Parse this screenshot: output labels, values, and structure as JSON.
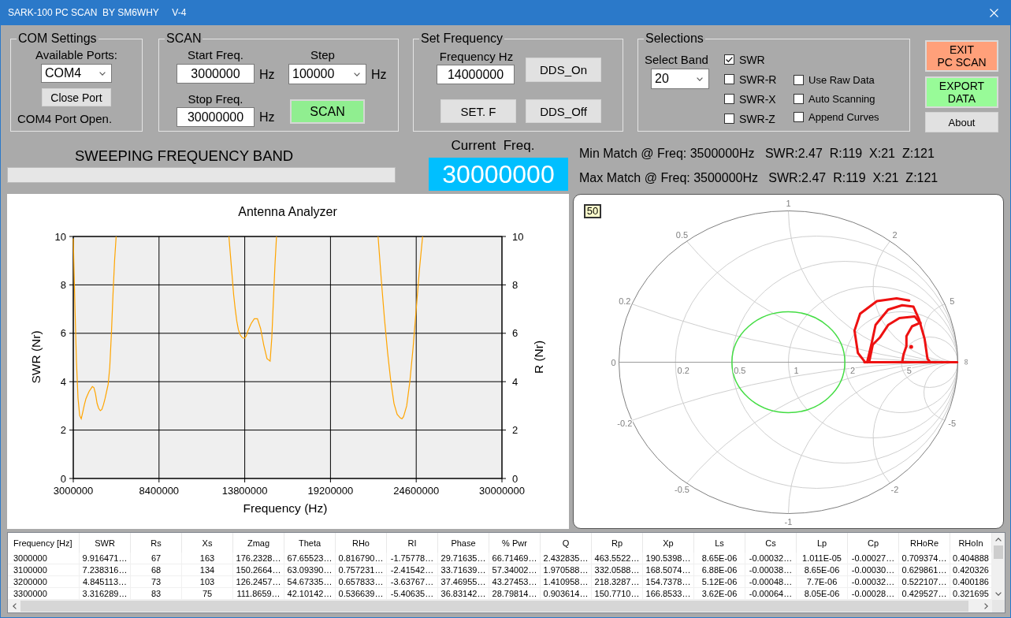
{
  "window": {
    "title": "SARK-100 PC SCAN  BY SM6WHY     V-4"
  },
  "com_settings": {
    "title": "COM Settings",
    "ports_label": "Available Ports:",
    "port": "COM4",
    "close_button": "Close Port",
    "status": "COM4 Port Open."
  },
  "scan": {
    "title": "SCAN",
    "start_label": "Start Freq.",
    "start_value": "3000000",
    "start_unit": "Hz",
    "step_label": "Step",
    "step_value": "100000",
    "step_unit": "Hz",
    "stop_label": "Stop Freq.",
    "stop_value": "30000000",
    "stop_unit": "Hz",
    "scan_button": "SCAN"
  },
  "set_frequency": {
    "title": "Set Frequency",
    "frequency_label": "Frequency Hz",
    "frequency_value": "14000000",
    "dds_on_button": "DDS_On",
    "set_button": "SET. F",
    "dds_off_button": "DDS_Off"
  },
  "selections": {
    "title": "Selections",
    "band_label": "Select Band",
    "band": "20",
    "curves": [
      {
        "label": "SWR",
        "checked": true
      },
      {
        "label": "SWR-R",
        "checked": false
      },
      {
        "label": "SWR-X",
        "checked": false
      },
      {
        "label": "SWR-Z",
        "checked": false
      }
    ],
    "options": [
      {
        "label": "Use Raw Data",
        "checked": false
      },
      {
        "label": "Auto Scanning",
        "checked": false
      },
      {
        "label": "Append Curves",
        "checked": false
      }
    ]
  },
  "actions": {
    "exit_button": "EXIT\nPC SCAN",
    "export_button": "EXPORT\nDATA",
    "about_button": "About"
  },
  "sweep": {
    "label": "SWEEPING FREQUENCY BAND",
    "progress": {
      "level": 0
    }
  },
  "current_frequency": {
    "label": "Current  Freq.",
    "value": "30000000"
  },
  "match": [
    "Min Match @ Freq: 3500000Hz   SWR:2.47  R:119  X:21  Z:121",
    "Max Match @ Freq: 3500000Hz   SWR:2.47  R:119  X:21  Z:121"
  ],
  "swr_chart": {
    "chart_data": {
      "type": "line",
      "title": "Antenna Analyzer",
      "xlabel": "Frequency (Hz)",
      "ylabel": "SWR (Nr)",
      "x": [
        3000000,
        3100000,
        3200000,
        3300000,
        3400000,
        3500000,
        3600000,
        3700000,
        3800000,
        3900000,
        4000000,
        4100000,
        4200000,
        4300000,
        4400000,
        4500000,
        4600000,
        4700000,
        4800000,
        4900000,
        5000000,
        5100000,
        5200000,
        5300000,
        5400000,
        5500000,
        5600000,
        5700000,
        5800000,
        12800000,
        12900000,
        13000000,
        13100000,
        13200000,
        13300000,
        13400000,
        13500000,
        13600000,
        13700000,
        13800000,
        13900000,
        14000000,
        14200000,
        14400000,
        14600000,
        14800000,
        15000000,
        15200000,
        15400000,
        15500000,
        15600000,
        15700000,
        15800000,
        15900000,
        22200000,
        22400000,
        22600000,
        22800000,
        23000000,
        23200000,
        23400000,
        23600000,
        23700000,
        23800000,
        24000000,
        24200000,
        24400000,
        24600000,
        24800000,
        25000000
      ],
      "series": [
        {
          "color": "#ffa500",
          "values": [
            9.92,
            7.24,
            4.85,
            3.32,
            2.6,
            2.47,
            2.75,
            3.05,
            3.3,
            3.45,
            3.6,
            3.7,
            3.8,
            3.75,
            3.5,
            3.1,
            2.9,
            2.8,
            2.85,
            3.05,
            3.3,
            3.6,
            3.9,
            4.6,
            6.0,
            7.6,
            9.0,
            10,
            null,
            10,
            9.2,
            8.4,
            7.6,
            7.0,
            6.5,
            6.15,
            5.95,
            5.85,
            5.8,
            5.8,
            5.9,
            6.1,
            6.4,
            6.6,
            6.6,
            6.2,
            5.5,
            4.95,
            4.85,
            5.8,
            7.3,
            8.8,
            10,
            null,
            10,
            8.2,
            6.6,
            5.2,
            4.0,
            3.1,
            2.65,
            2.5,
            2.47,
            2.55,
            3.0,
            4.0,
            5.4,
            7.0,
            8.6,
            10
          ]
        }
      ],
      "xlim": [
        3000000,
        30000000
      ],
      "ylim": [
        0,
        10
      ],
      "xticks": [
        3000000,
        8400000,
        13800000,
        19200000,
        24600000,
        30000000
      ],
      "yticks": [
        0,
        2,
        4,
        6,
        8,
        10
      ],
      "grid": true
    },
    "right_axis": {
      "label": "R (Nr)",
      "ticks": [
        "10",
        "8",
        "6",
        "4",
        "2",
        "0"
      ]
    }
  },
  "smith_chart": {
    "badge": "50",
    "resistance_labels": [
      "0",
      "0.2",
      "0.5",
      "1",
      "2",
      "5",
      "∞"
    ],
    "reactance_labels": [
      "0.2",
      "0.5",
      "1",
      "2",
      "5",
      "-0.2",
      "-0.5",
      "-1",
      "-2",
      "-5"
    ]
  },
  "table": {
    "columns": [
      "Frequency [Hz]",
      "SWR",
      "Rs",
      "Xs",
      "Zmag",
      "Theta",
      "RHo",
      "RI",
      "Phase",
      "% Pwr",
      "Q",
      "Rp",
      "Xp",
      "Ls",
      "Cs",
      "Lp",
      "Cp",
      "RHoRe",
      "RHoIn"
    ],
    "rows": [
      [
        "3000000",
        "9.916471…",
        "67",
        "163",
        "176.2328…",
        "67.65523…",
        "0.816790…",
        "-1.75778…",
        "29.71635…",
        "66.71469…",
        "2.432835…",
        "463.5522…",
        "190.5398…",
        "8.65E-06",
        "-0.00032…",
        "1.011E-05",
        "-0.00027…",
        "0.709374…",
        "0.404888"
      ],
      [
        "3100000",
        "7.238316…",
        "68",
        "134",
        "150.2664…",
        "63.09390…",
        "0.757231…",
        "-2.41542…",
        "33.71639…",
        "57.34002…",
        "1.970588…",
        "332.0588…",
        "168.5074…",
        "6.88E-06",
        "-0.00038…",
        "8.65E-06",
        "-0.00030…",
        "0.629861…",
        "0.420326"
      ],
      [
        "3200000",
        "4.845113…",
        "73",
        "103",
        "126.2457…",
        "54.67335…",
        "0.657833…",
        "-3.63767…",
        "37.46955…",
        "43.27453…",
        "1.410958…",
        "218.3287…",
        "154.7378…",
        "5.12E-06",
        "-0.00048…",
        "7.7E-06",
        "-0.00032…",
        "0.522107…",
        "0.400186"
      ],
      [
        "3300000",
        "3.316289…",
        "83",
        "75",
        "111.8659…",
        "42.10142…",
        "0.536639…",
        "-5.40635…",
        "36.83142…",
        "28.79814…",
        "0.903614…",
        "150.7710…",
        "166.8533…",
        "3.62E-06",
        "-0.00064…",
        "8.05E-06",
        "-0.00028…",
        "0.429527…",
        "0.321695"
      ]
    ]
  }
}
